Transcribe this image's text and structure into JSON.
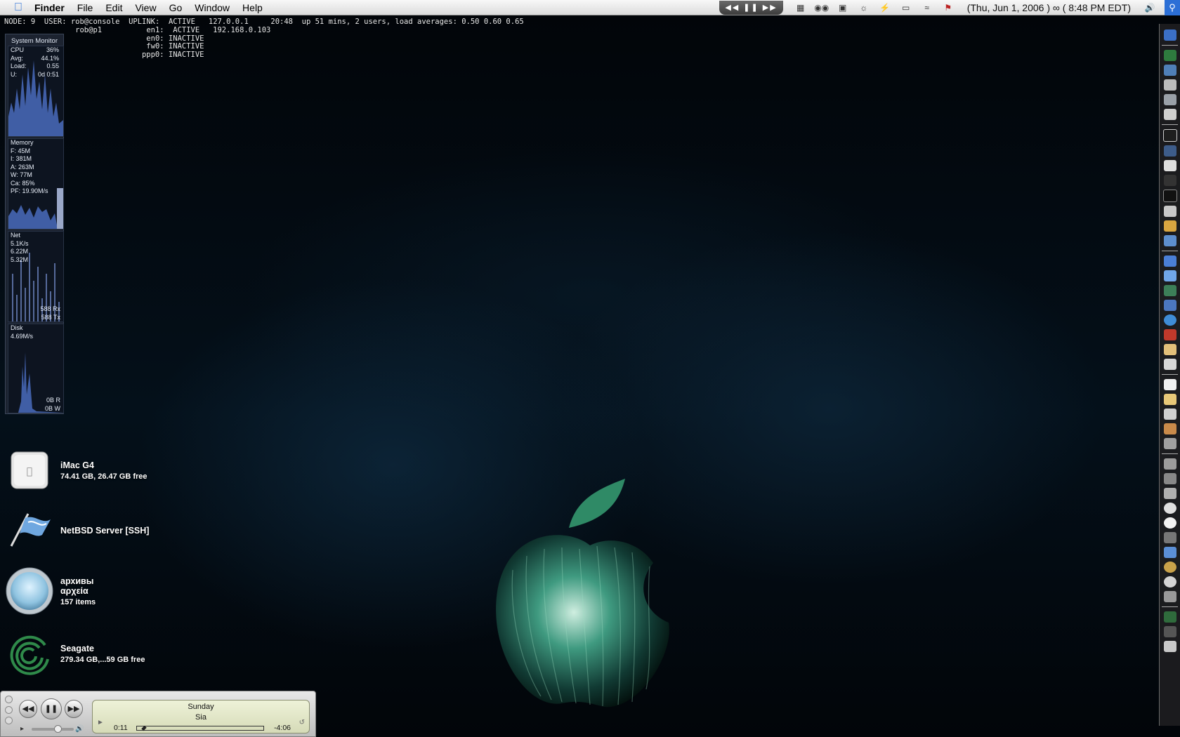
{
  "menubar": {
    "app": "Finder",
    "items": [
      "File",
      "Edit",
      "View",
      "Go",
      "Window",
      "Help"
    ],
    "clock": "(Thu, Jun 1, 2006 ) ∞ ( 8:48 PM EDT)",
    "tray_icons": [
      "media-controls-icon",
      "window-icon",
      "binoculars-icon",
      "app-icon",
      "palette-icon",
      "lightning-icon",
      "display-icon",
      "wifi-icon",
      "us-flag-icon",
      "volume-icon",
      "spotlight-icon"
    ],
    "accent": "#2c6fd6"
  },
  "terminal": {
    "node": "NODE: 9",
    "user_label": "USER:",
    "user1": "rob@console",
    "user2": "rob@p1",
    "uplink": "UPLINK:",
    "if1": "ACTIVE   127.0.0.1",
    "uptime": "20:48  up 51 mins, 2 users, load averages: 0.50 0.60 0.65",
    "en1": "en1:",
    "en1_val": "ACTIVE   192.168.0.103",
    "en0": "en0:",
    "en0_val": "INACTIVE",
    "fw0": "fw0:",
    "fw0_val": "INACTIVE",
    "ppp0": "ppp0:",
    "ppp0_val": "INACTIVE"
  },
  "sysmon": {
    "title": "System Monitor",
    "cpu": {
      "label": "CPU",
      "value": "36%",
      "avg_label": "Avg:",
      "avg": "44.1%",
      "load_label": "Load:",
      "load": "0.55",
      "u_label": "U:",
      "u": "0d 0:51"
    },
    "memory": {
      "label": "Memory",
      "f": "F: 45M",
      "i": "I: 381M",
      "a": "A: 263M",
      "w": "W: 77M",
      "ca": "Ca: 85%",
      "pf": "PF: 19.90M/s"
    },
    "net": {
      "label": "Net",
      "rate": "5.1K/s",
      "in": "6.22M",
      "out": "5.32M",
      "rx": "588 Rx",
      "tx": "588 Tx"
    },
    "disk": {
      "label": "Disk",
      "rate": "4.69M/s",
      "r": "0B R",
      "w": "0B W"
    }
  },
  "icons": [
    {
      "name": "iMac G4",
      "detail": "74.41 GB, 26.47 GB free"
    },
    {
      "name": "NetBSD Server [SSH]",
      "detail": ""
    },
    {
      "name": "архивы",
      "name2": "αρχεία",
      "detail": "157 items"
    },
    {
      "name": "Seagate",
      "detail": "279.34 GB,...59 GB free"
    }
  ],
  "itunes": {
    "song": "Sunday",
    "artist": "Sia",
    "elapsed": "0:11",
    "remaining": "-4:06",
    "progress": 0.04,
    "volume": 0.6
  }
}
